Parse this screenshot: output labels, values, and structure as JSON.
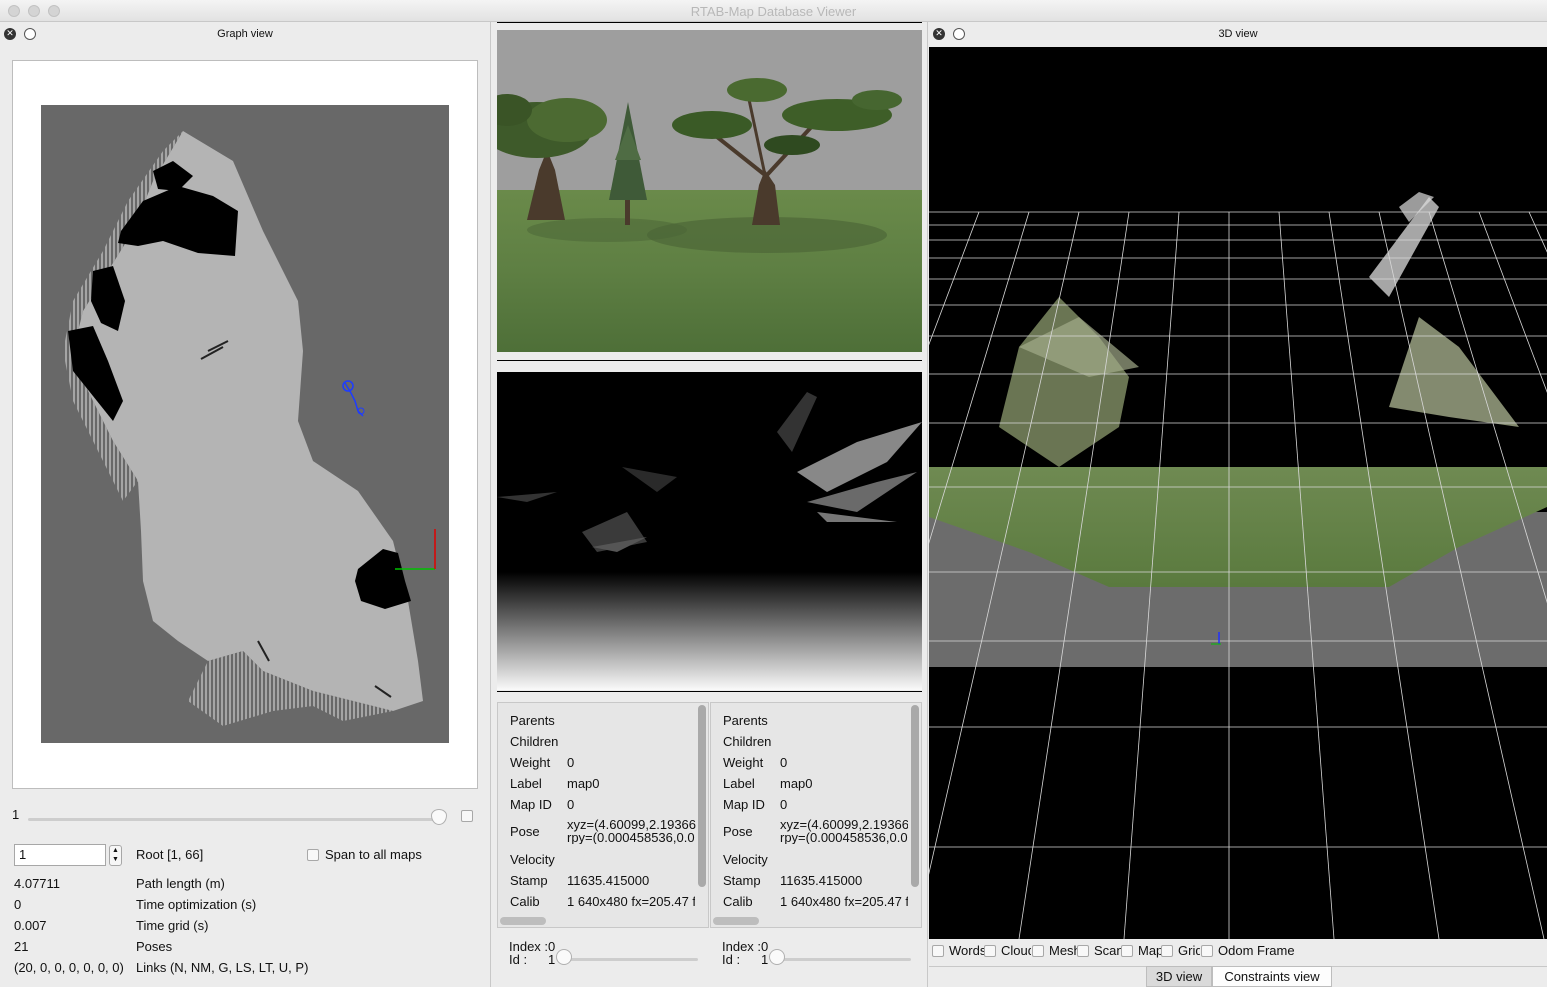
{
  "window": {
    "title": "RTAB-Map Database Viewer"
  },
  "graph_view": {
    "title": "Graph view",
    "slider_value": "1",
    "id_value": "1",
    "root_label": "Root [1, 66]",
    "span_label": "Span to all maps",
    "stats": [
      {
        "value": "4.07711",
        "label": "Path length (m)"
      },
      {
        "value": "0",
        "label": "Time optimization (s)"
      },
      {
        "value": "0.007",
        "label": "Time grid (s)"
      },
      {
        "value": "21",
        "label": "Poses"
      },
      {
        "value": "(20, 0, 0, 0, 0, 0, 0)",
        "label": "Links (N, NM, G, LS, LT, U, P)"
      }
    ]
  },
  "node_info_left": {
    "rows": [
      {
        "label": "Parents",
        "value": ""
      },
      {
        "label": "Children",
        "value": ""
      },
      {
        "label": "Weight",
        "value": "0"
      },
      {
        "label": "Label",
        "value": "map0"
      },
      {
        "label": "Map ID",
        "value": "0"
      },
      {
        "label": "Pose",
        "value": "xyz=(4.60099,2.19366",
        "value2": "rpy=(0.000458536,0.0"
      },
      {
        "label": "Velocity",
        "value": ""
      },
      {
        "label": "Stamp",
        "value": "11635.415000"
      },
      {
        "label": "Calib",
        "value": "1 640x480 fx=205.47 f"
      }
    ],
    "index_label": "Index :0",
    "id_label": "Id :",
    "id_value": "1"
  },
  "node_info_right": {
    "rows": [
      {
        "label": "Parents",
        "value": ""
      },
      {
        "label": "Children",
        "value": ""
      },
      {
        "label": "Weight",
        "value": "0"
      },
      {
        "label": "Label",
        "value": "map0"
      },
      {
        "label": "Map ID",
        "value": "0"
      },
      {
        "label": "Pose",
        "value": "xyz=(4.60099,2.19366",
        "value2": "rpy=(0.000458536,0.0"
      },
      {
        "label": "Velocity",
        "value": ""
      },
      {
        "label": "Stamp",
        "value": "11635.415000"
      },
      {
        "label": "Calib",
        "value": "1 640x480 fx=205.47 f"
      }
    ],
    "index_label": "Index :0",
    "id_label": "Id :",
    "id_value": "1"
  },
  "view_3d": {
    "title": "3D view",
    "checkboxes": [
      "Words",
      "Cloud",
      "Mesh",
      "Scan",
      "Map",
      "Grid",
      "Odom Frame"
    ],
    "tabs": [
      "3D view",
      "Constraints view"
    ]
  },
  "colors": {
    "map_background": "#686868",
    "free_space": "#b4b4b4",
    "obstacle": "#000000",
    "trajectory": "#1e3cff",
    "grid_line": "#d8d8d8"
  }
}
